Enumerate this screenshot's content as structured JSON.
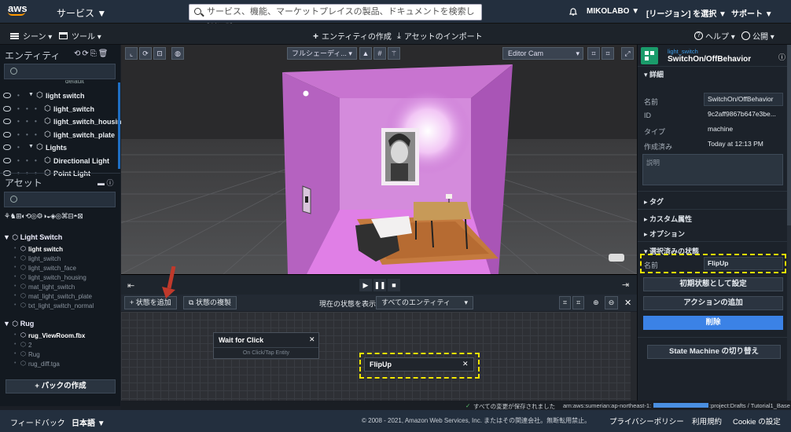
{
  "topbar": {
    "logo": "aws",
    "services": "サービス ▼",
    "search_placeholder": "サービス、機能、マーケットプレイスの製品、ドキュメントを検索し  [Alt+S]",
    "user": "MIKOLABO ▼",
    "region": "[リージョン] を選択 ▼",
    "support": "サポート ▼"
  },
  "toolbar": {
    "scene": "シーン ▾",
    "tools": "ツール ▾",
    "create_entity": "エンティティの作成",
    "import_asset": "アセットのインポート",
    "help": "ヘルプ ▾",
    "publish": "公開 ▾"
  },
  "entities": {
    "title": "エンティティ",
    "partial_top": "default",
    "rows": [
      {
        "label": "light switch",
        "indent": 1,
        "arrow": "▼"
      },
      {
        "label": "light_switch",
        "indent": 2,
        "arrow": ""
      },
      {
        "label": "light_switch_housin",
        "indent": 2,
        "arrow": ""
      },
      {
        "label": "light_switch_plate",
        "indent": 2,
        "arrow": ""
      },
      {
        "label": "Lights",
        "indent": 1,
        "arrow": "▼"
      },
      {
        "label": "Directional Light",
        "indent": 2,
        "arrow": ""
      },
      {
        "label": "Point Light",
        "indent": 2,
        "arrow": ""
      }
    ]
  },
  "assets": {
    "title": "アセット",
    "group1": "Light Switch",
    "group1_items": [
      "light switch",
      "light_switch",
      "light_switch_face",
      "light_switch_housing",
      "mat_light_switch",
      "mat_light_switch_plate",
      "txt_light_switch_normal"
    ],
    "group2": "Rug",
    "group2_items": [
      "rug_ViewRoom.fbx",
      "2",
      "Rug",
      "rug_diff.tga"
    ],
    "create_pack": "+ パックの作成"
  },
  "viewport": {
    "shading": "フルシェーディ...",
    "camera": "Editor Cam"
  },
  "state_machine": {
    "add_state": "状態を追加",
    "duplicate_state": "状態の複製",
    "show_state_label": "現在の状態を表示",
    "entity_filter": "すべてのエンティティ",
    "state1_title": "Wait for Click",
    "state1_action": "On Click/Tap Entity",
    "state2_title": "FlipUp"
  },
  "inspector": {
    "entity_small": "light_switch",
    "behavior_name": "SwitchOn/OffBehavior",
    "details": "詳細",
    "name_label": "名前",
    "name_value": "SwitchOn/OffBehavior",
    "id_label": "ID",
    "id_value": "9c2aff9867b647e3be...",
    "type_label": "タイプ",
    "type_value": "machine",
    "created_label": "作成済み",
    "created_value": "Today at 12:13 PM",
    "description_placeholder": "説明",
    "tags": "タグ",
    "custom_attrs": "カスタム属性",
    "options": "オプション",
    "selected_state": "選択済みの状態",
    "state_name_label": "名前",
    "state_name_value": "FlipUp",
    "set_initial": "初期状態として設定",
    "add_action": "アクションの追加",
    "delete": "削除",
    "toggle_sm": "State Machine の切り替え"
  },
  "status": {
    "saved": "すべての変更が保存されました",
    "arn_prefix": "arn:aws:sumerian:ap-northeast-1:",
    "arn_suffix": ":project:Drafts / Tutorial1_Base"
  },
  "footer": {
    "feedback": "フィードバック",
    "language": "日本語 ▼",
    "copyright": "© 2008 - 2021, Amazon Web Services, Inc. またはその関連会社。無断転用禁止。",
    "privacy": "プライバシーポリシー",
    "terms": "利用規約",
    "cookie": "Cookie の設定"
  },
  "colors": {
    "accent_blue": "#3b82e6",
    "highlight_yellow": "#f2e600",
    "room_pink": "#c86fd0",
    "brand_green": "#1a9c6b"
  }
}
